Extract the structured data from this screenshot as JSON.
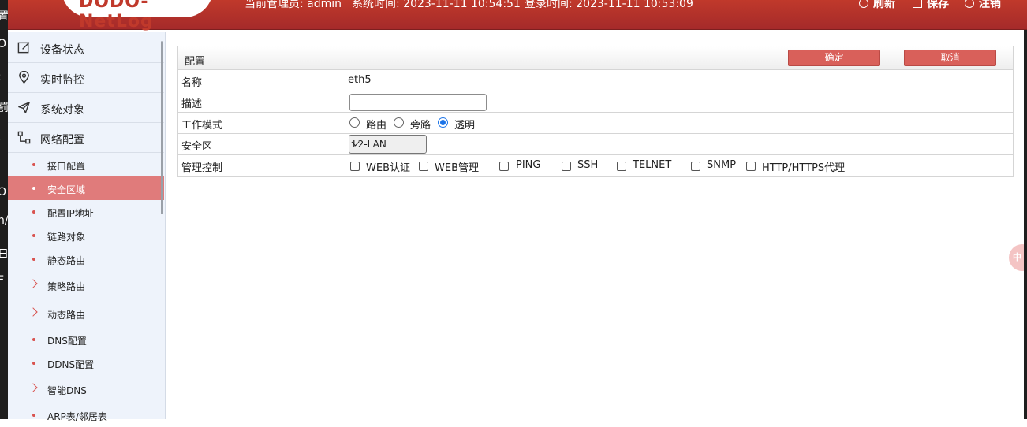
{
  "header": {
    "logo_text": "DODO-NetLog",
    "admin_text": "当前管理员: admin",
    "system_time_text": "系统时间: 2023-11-11 10:54:51",
    "login_time_text": "登录时间: 2023-11-11 10:53:09",
    "refresh_label": "刷新",
    "save_label": "保存",
    "logout_label": "注销"
  },
  "left_strip": {
    "glyphs": [
      "置",
      "O",
      ";",
      "罰",
      ",",
      "O",
      "n/",
      "日",
      "F"
    ]
  },
  "sidebar": {
    "main_items": [
      {
        "label": "设备状态",
        "icon": "edit-icon"
      },
      {
        "label": "实时监控",
        "icon": "location-pin-icon"
      },
      {
        "label": "系统对象",
        "icon": "paper-plane-icon"
      },
      {
        "label": "网络配置",
        "icon": "network-icon"
      }
    ],
    "sub_items": [
      {
        "label": "接口配置",
        "type": "dot"
      },
      {
        "label": "安全区域",
        "type": "dot",
        "active": true
      },
      {
        "label": "配置IP地址",
        "type": "dot"
      },
      {
        "label": "链路对象",
        "type": "dot"
      },
      {
        "label": "静态路由",
        "type": "dot"
      },
      {
        "label": "策略路由",
        "type": "chevron"
      },
      {
        "label": "动态路由",
        "type": "chevron"
      },
      {
        "label": "DNS配置",
        "type": "dot"
      },
      {
        "label": "DDNS配置",
        "type": "dot"
      },
      {
        "label": "智能DNS",
        "type": "chevron"
      },
      {
        "label": "ARP表/邻居表",
        "type": "dot"
      }
    ]
  },
  "panel": {
    "title": "配置",
    "confirm_label": "确定",
    "cancel_label": "取消",
    "rows": {
      "name_label": "名称",
      "name_value": "eth5",
      "desc_label": "描述",
      "desc_value": "",
      "mode_label": "工作模式",
      "mode_options": [
        "路由",
        "旁路",
        "透明"
      ],
      "mode_selected": "透明",
      "zone_label": "安全区",
      "zone_value": "L2-LAN",
      "mgmt_label": "管理控制",
      "mgmt_options": [
        "WEB认证",
        "WEB管理",
        "PING",
        "SSH",
        "TELNET",
        "SNMP",
        "HTTP/HTTPS代理"
      ]
    }
  },
  "floating": {
    "text": "中"
  },
  "colors": {
    "header_red": "#b03030",
    "button_red": "#d9605a",
    "active_item": "#e07b7b",
    "sidebar_bg": "#eef3fb",
    "radio_blue": "#1a73e8"
  }
}
